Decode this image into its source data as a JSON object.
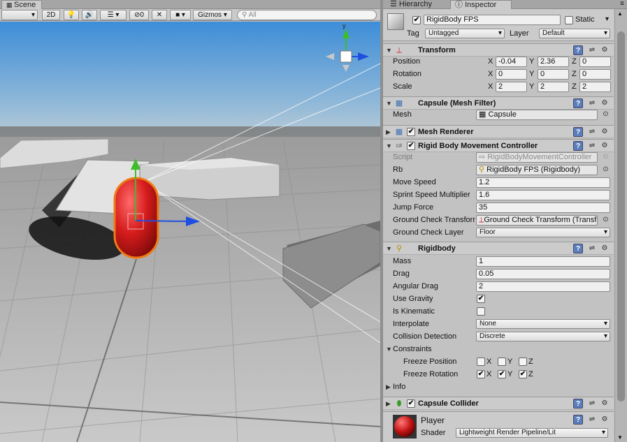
{
  "scene": {
    "tab_label": "Scene",
    "toolbar": {
      "shading_mode": "",
      "toggle_2d": "2D",
      "hidden_objects_count": "0",
      "gizmos_label": "Gizmos",
      "search_placeholder": "All"
    }
  },
  "hierarchy": {
    "tab_label": "Hierarchy"
  },
  "inspector": {
    "tab_label": "Inspector",
    "game_object": {
      "name": "RigidBody FPS",
      "active": true,
      "static_label": "Static",
      "static": false,
      "tag_label": "Tag",
      "tag": "Untagged",
      "layer_label": "Layer",
      "layer": "Default"
    },
    "transform": {
      "title": "Transform",
      "position_label": "Position",
      "position": {
        "x": "-0.04",
        "y": "2.36",
        "z": "0"
      },
      "rotation_label": "Rotation",
      "rotation": {
        "x": "0",
        "y": "0",
        "z": "0"
      },
      "scale_label": "Scale",
      "scale": {
        "x": "2",
        "y": "2",
        "z": "2"
      },
      "axis_x": "X",
      "axis_y": "Y",
      "axis_z": "Z"
    },
    "mesh_filter": {
      "title": "Capsule (Mesh Filter)",
      "mesh_label": "Mesh",
      "mesh": "Capsule"
    },
    "mesh_renderer": {
      "title": "Mesh Renderer",
      "enabled": true
    },
    "movement_controller": {
      "title": "Rigid Body Movement Controller",
      "enabled": true,
      "script_label": "Script",
      "script": "RigidBodyMovementController",
      "rb_label": "Rb",
      "rb": "RigidBody FPS (Rigidbody)",
      "move_speed_label": "Move Speed",
      "move_speed": "1.2",
      "sprint_label": "Sprint Speed Multiplier",
      "sprint": "1.6",
      "jump_label": "Jump Force",
      "jump": "35",
      "ground_check_label": "Ground Check Transform",
      "ground_check": "Ground Check Transform (Transform)",
      "ground_layer_label": "Ground Check Layer",
      "ground_layer": "Floor"
    },
    "rigidbody": {
      "title": "Rigidbody",
      "mass_label": "Mass",
      "mass": "1",
      "drag_label": "Drag",
      "drag": "0.05",
      "angular_drag_label": "Angular Drag",
      "angular_drag": "2",
      "use_gravity_label": "Use Gravity",
      "use_gravity": true,
      "is_kinematic_label": "Is Kinematic",
      "is_kinematic": false,
      "interpolate_label": "Interpolate",
      "interpolate": "None",
      "collision_label": "Collision Detection",
      "collision": "Discrete",
      "constraints_label": "Constraints",
      "freeze_position_label": "Freeze Position",
      "freeze_position": {
        "x": false,
        "y": false,
        "z": false
      },
      "freeze_rotation_label": "Freeze Rotation",
      "freeze_rotation": {
        "x": true,
        "y": true,
        "z": true
      },
      "axis_x": "X",
      "axis_y": "Y",
      "axis_z": "Z",
      "info_label": "Info"
    },
    "capsule_collider": {
      "title": "Capsule Collider",
      "enabled": true
    },
    "material": {
      "name": "Player",
      "shader_label": "Shader",
      "shader": "Lightweight Render Pipeline/Lit"
    }
  },
  "colors": {
    "capsule": "#d61c1c",
    "selection_outline": "#f07a14",
    "gizmo_x": "#1f4fe0",
    "gizmo_y": "#3dbd2a"
  }
}
